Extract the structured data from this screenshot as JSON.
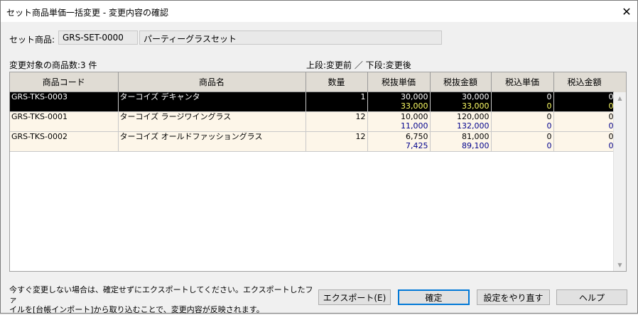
{
  "window": {
    "title": "セット商品単価一括変更 - 変更内容の確認",
    "close_glyph": "✕"
  },
  "set_product": {
    "label": "セット商品:",
    "code": "GRS-SET-0000",
    "name": "パーティーグラスセット"
  },
  "summary": {
    "count_label": "変更対象の商品数:3 件",
    "legend": "上段:変更前 ／ 下段:変更後"
  },
  "table": {
    "columns": [
      "商品コード",
      "商品名",
      "数量",
      "税抜単価",
      "税抜金額",
      "税込単価",
      "税込金額"
    ],
    "rows": [
      {
        "code": "GRS-TKS-0003",
        "name": "ターコイズ デキャンタ",
        "qty": "1",
        "unit_before": "30,000",
        "unit_after": "33,000",
        "amount_before": "30,000",
        "amount_after": "33,000",
        "tax_unit_before": "0",
        "tax_unit_after": "0",
        "tax_amount_before": "0",
        "tax_amount_after": "0"
      },
      {
        "code": "GRS-TKS-0001",
        "name": "ターコイズ ラージワイングラス",
        "qty": "12",
        "unit_before": "10,000",
        "unit_after": "11,000",
        "amount_before": "120,000",
        "amount_after": "132,000",
        "tax_unit_before": "0",
        "tax_unit_after": "0",
        "tax_amount_before": "0",
        "tax_amount_after": "0"
      },
      {
        "code": "GRS-TKS-0002",
        "name": "ターコイズ オールドファッショングラス",
        "qty": "12",
        "unit_before": "6,750",
        "unit_after": "7,425",
        "amount_before": "81,000",
        "amount_after": "89,100",
        "tax_unit_before": "0",
        "tax_unit_after": "0",
        "tax_amount_before": "0",
        "tax_amount_after": "0"
      }
    ]
  },
  "footer": {
    "message_line1": "今すぐ変更しない場合は、確定せずにエクスポートしてください。エクスポートしたファ",
    "message_line2": "イルを[台帳インポート]から取り込むことで、変更内容が反映されます。",
    "export_label": "エクスポート(E)",
    "confirm_label": "確定",
    "redo_label": "設定をやり直す",
    "help_label": "ヘルプ"
  }
}
